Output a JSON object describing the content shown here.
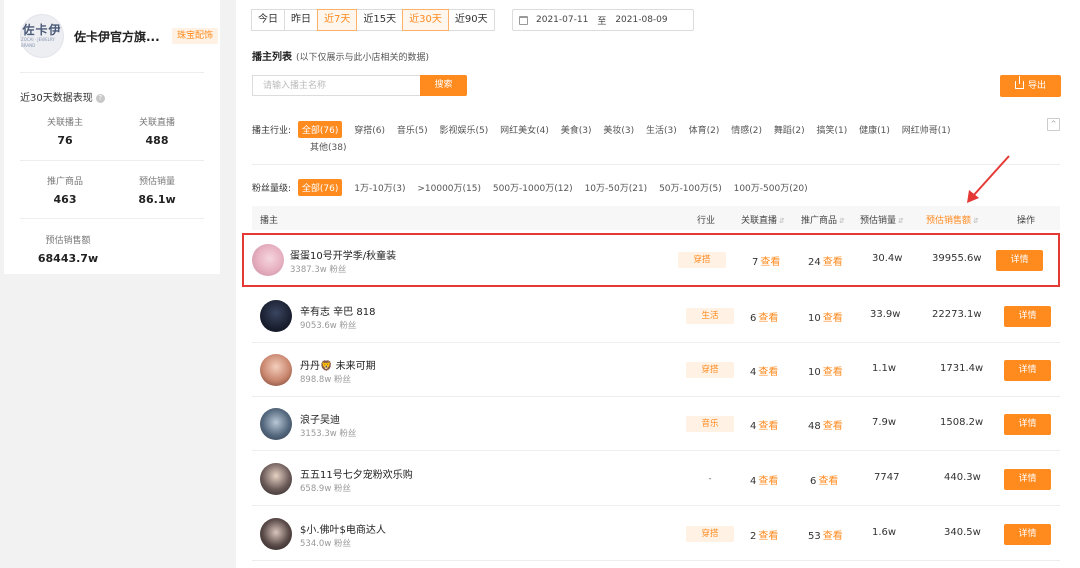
{
  "store": {
    "logo_text": "佐卡伊",
    "logo_sub": "ZOCAI · JEWELRY BRAND",
    "name": "佐卡伊官方旗...",
    "tag": "珠宝配饰"
  },
  "stats": {
    "title": "近30天数据表现",
    "info": "?",
    "items": [
      {
        "label": "关联播主",
        "value": "76"
      },
      {
        "label": "关联直播",
        "value": "488"
      },
      {
        "label": "推广商品",
        "value": "463"
      },
      {
        "label": "预估销量",
        "value": "86.1w"
      },
      {
        "label": "预估销售额",
        "value": "68443.7w"
      }
    ]
  },
  "date_tabs": [
    "今日",
    "昨日",
    "近7天",
    "近15天",
    "近30天",
    "近90天"
  ],
  "date_range": {
    "start": "2021-07-11",
    "sep": "至",
    "end": "2021-08-09"
  },
  "list": {
    "title": "播主列表",
    "subtitle": "(以下仅展示与此小店相关的数据)",
    "search_placeholder": "请输入播主名称",
    "search_label": "搜索",
    "export_label": "导出"
  },
  "industry_filter": {
    "label": "播主行业:",
    "row1": [
      "全部(76)",
      "穿搭(6)",
      "音乐(5)",
      "影视娱乐(5)",
      "网红美女(4)",
      "美食(3)",
      "美妆(3)",
      "生活(3)",
      "体育(2)",
      "情感(2)",
      "舞蹈(2)",
      "搞笑(1)",
      "健康(1)",
      "网红帅哥(1)"
    ],
    "row2": [
      "其他(38)"
    ],
    "collapse": "^"
  },
  "fans_filter": {
    "label": "粉丝量级:",
    "options": [
      "全部(76)",
      "1万-10万(3)",
      ">10000万(15)",
      "500万-1000万(12)",
      "10万-50万(21)",
      "50万-100万(5)",
      "100万-500万(20)"
    ]
  },
  "table": {
    "headers": {
      "name": "播主",
      "industry": "行业",
      "lives": "关联直播",
      "products": "推广商品",
      "sales": "预估销量",
      "revenue": "预估销售额",
      "action": "操作"
    },
    "sort": "⇵",
    "view": "查看",
    "detail": "详情",
    "rows": [
      {
        "name": "蛋蛋10号开学季/秋童装",
        "fans": "3387.3w 粉丝",
        "industry": "穿搭",
        "lives": "7",
        "products": "24",
        "sales": "30.4w",
        "revenue": "39955.6w"
      },
      {
        "name": "辛有志 辛巴 818",
        "fans": "9053.6w 粉丝",
        "industry": "生活",
        "lives": "6",
        "products": "10",
        "sales": "33.9w",
        "revenue": "22273.1w"
      },
      {
        "name": "丹丹🦁 未来可期",
        "fans": "898.8w 粉丝",
        "industry": "穿搭",
        "lives": "4",
        "products": "10",
        "sales": "1.1w",
        "revenue": "1731.4w"
      },
      {
        "name": "浪子吴迪",
        "fans": "3153.3w 粉丝",
        "industry": "音乐",
        "lives": "4",
        "products": "48",
        "sales": "7.9w",
        "revenue": "1508.2w"
      },
      {
        "name": "五五11号七夕宠粉欢乐购",
        "fans": "658.9w 粉丝",
        "industry": "-",
        "lives": "4",
        "products": "6",
        "sales": "7747",
        "revenue": "440.3w"
      },
      {
        "name": "$小.佛叶$电商达人",
        "fans": "534.0w 粉丝",
        "industry": "穿搭",
        "lives": "2",
        "products": "53",
        "sales": "1.6w",
        "revenue": "340.5w"
      }
    ]
  },
  "colors": {
    "accent": "#ff8a1e",
    "highlight_border": "#e53935"
  }
}
